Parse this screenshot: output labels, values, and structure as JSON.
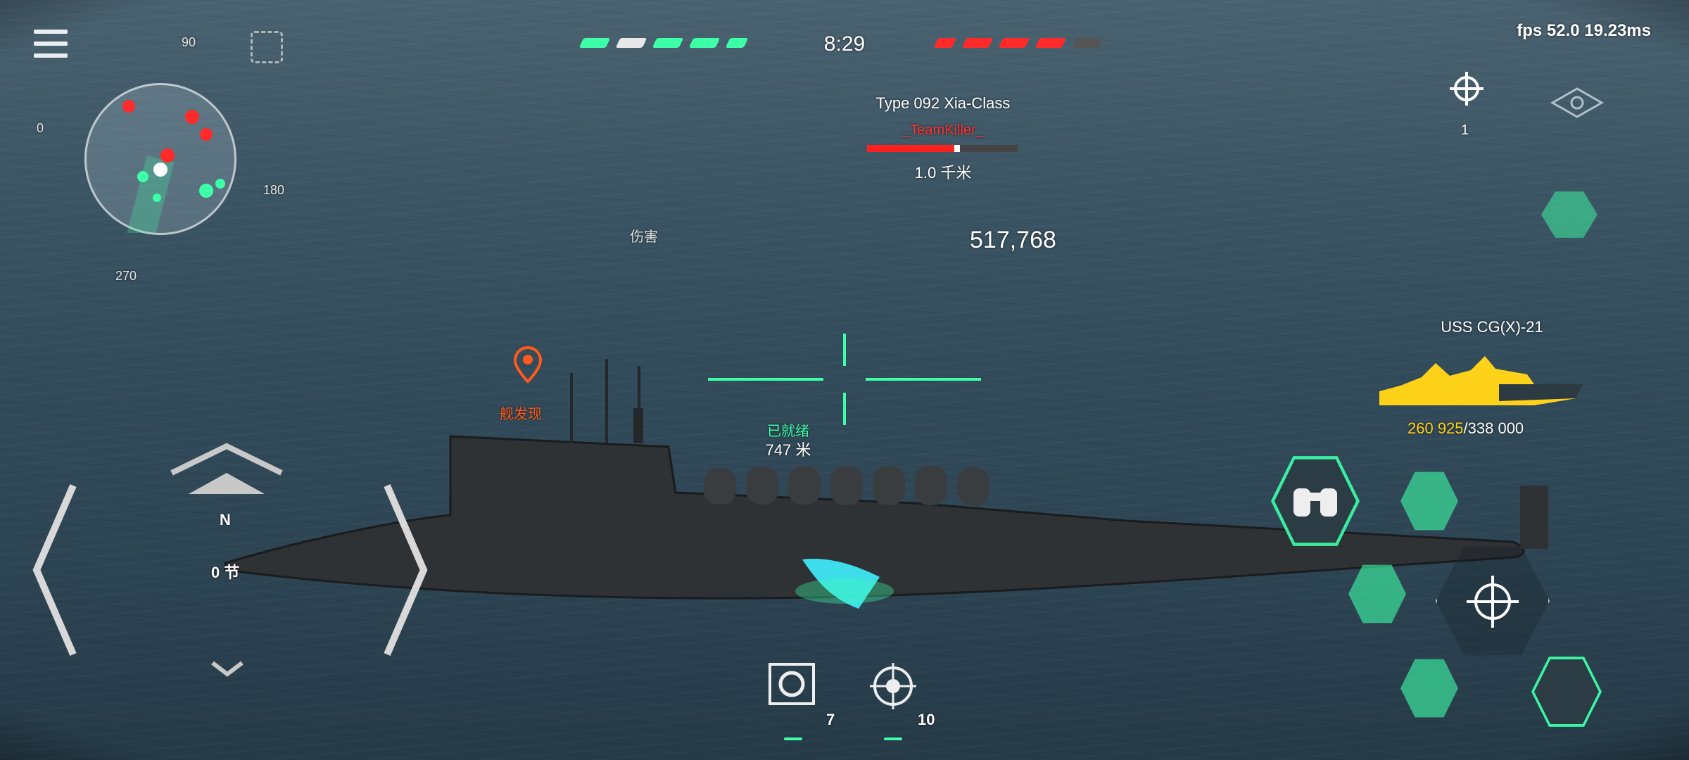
{
  "hud": {
    "timer": "8:29",
    "fps": "fps 52.0  19.23ms",
    "damage_label": "伤害",
    "damage_value": "517,768"
  },
  "minimap": {
    "tick_90": "90",
    "tick_0": "0",
    "tick_180": "180",
    "tick_270": "270"
  },
  "target": {
    "ship_name": "Type 092 Xia-Class",
    "player_name": "_TeamKiller_",
    "distance": "1.0 千米",
    "hp_fraction": 0.58
  },
  "weapon": {
    "status": "已就绪",
    "range": "747 米"
  },
  "marker": {
    "label": "舰发现"
  },
  "right_panel": {
    "target_count": "1",
    "own_ship_name": "USS CG(X)-21",
    "own_hp_current": "260 925",
    "own_hp_max": "/338 000"
  },
  "movement": {
    "heading": "N",
    "speed": "0 节"
  },
  "bottom": {
    "ability1_count": "7",
    "ability2_count": "10"
  },
  "colors": {
    "friendly": "#3dffa8",
    "enemy": "#ff3030",
    "own_ship": "#ffd21a"
  }
}
